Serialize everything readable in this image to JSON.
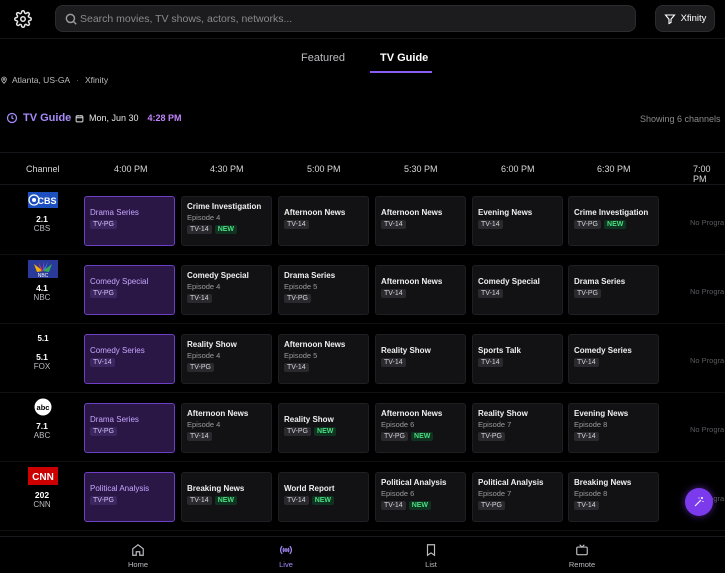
{
  "search": {
    "placeholder": "Search movies, TV shows, actors, networks..."
  },
  "provider_label": "Xfinity",
  "tabs": [
    {
      "label": "Featured",
      "active": false
    },
    {
      "label": "TV Guide",
      "active": true
    }
  ],
  "location": {
    "city": "Atlanta, US-GA",
    "provider": "Xfinity"
  },
  "guide": {
    "title": "TV Guide",
    "date": "Mon, Jun 30",
    "current_time": "4:28 PM",
    "showing": "Showing 6 channels",
    "channel_header": "Channel",
    "time_slots": [
      "4:00 PM",
      "4:30 PM",
      "5:00 PM",
      "5:30 PM",
      "6:00 PM",
      "6:30 PM",
      "7:00 PM"
    ],
    "no_program_label": "No Progra"
  },
  "channels": [
    {
      "number": "2.1",
      "name": "CBS",
      "logo": "CBS",
      "programs": [
        {
          "title": "Drama Series",
          "episode": "",
          "rating": "TV-PG",
          "new": false,
          "current": true
        },
        {
          "title": "Crime Investigation",
          "episode": "Episode 4",
          "rating": "TV-14",
          "new": true,
          "current": false
        },
        {
          "title": "Afternoon News",
          "episode": "",
          "rating": "TV-14",
          "new": false,
          "current": false
        },
        {
          "title": "Afternoon News",
          "episode": "",
          "rating": "TV-14",
          "new": false,
          "current": false
        },
        {
          "title": "Evening News",
          "episode": "",
          "rating": "TV-14",
          "new": false,
          "current": false
        },
        {
          "title": "Crime Investigation",
          "episode": "",
          "rating": "TV-PG",
          "new": true,
          "current": false
        }
      ]
    },
    {
      "number": "4.1",
      "name": "NBC",
      "logo": "NBC",
      "programs": [
        {
          "title": "Comedy Special",
          "episode": "",
          "rating": "TV-PG",
          "new": false,
          "current": true
        },
        {
          "title": "Comedy Special",
          "episode": "Episode 4",
          "rating": "TV-14",
          "new": false,
          "current": false
        },
        {
          "title": "Drama Series",
          "episode": "Episode 5",
          "rating": "TV-PG",
          "new": false,
          "current": false
        },
        {
          "title": "Afternoon News",
          "episode": "",
          "rating": "TV-14",
          "new": false,
          "current": false
        },
        {
          "title": "Comedy Special",
          "episode": "",
          "rating": "TV-14",
          "new": false,
          "current": false
        },
        {
          "title": "Drama Series",
          "episode": "",
          "rating": "TV-PG",
          "new": false,
          "current": false
        }
      ]
    },
    {
      "number": "5.1",
      "name": "FOX",
      "logo": "5.1",
      "programs": [
        {
          "title": "Comedy Series",
          "episode": "",
          "rating": "TV-14",
          "new": false,
          "current": true
        },
        {
          "title": "Reality Show",
          "episode": "Episode 4",
          "rating": "TV-PG",
          "new": false,
          "current": false
        },
        {
          "title": "Afternoon News",
          "episode": "Episode 5",
          "rating": "TV-14",
          "new": false,
          "current": false
        },
        {
          "title": "Reality Show",
          "episode": "",
          "rating": "TV-14",
          "new": false,
          "current": false
        },
        {
          "title": "Sports Talk",
          "episode": "",
          "rating": "TV-14",
          "new": false,
          "current": false
        },
        {
          "title": "Comedy Series",
          "episode": "",
          "rating": "TV-14",
          "new": false,
          "current": false
        }
      ]
    },
    {
      "number": "7.1",
      "name": "ABC",
      "logo": "abc",
      "programs": [
        {
          "title": "Drama Series",
          "episode": "",
          "rating": "TV-PG",
          "new": false,
          "current": true
        },
        {
          "title": "Afternoon News",
          "episode": "Episode 4",
          "rating": "TV-14",
          "new": false,
          "current": false
        },
        {
          "title": "Reality Show",
          "episode": "",
          "rating": "TV-PG",
          "new": true,
          "current": false
        },
        {
          "title": "Afternoon News",
          "episode": "Episode 6",
          "rating": "TV-PG",
          "new": true,
          "current": false
        },
        {
          "title": "Reality Show",
          "episode": "Episode 7",
          "rating": "TV-PG",
          "new": false,
          "current": false
        },
        {
          "title": "Evening News",
          "episode": "Episode 8",
          "rating": "TV-14",
          "new": false,
          "current": false
        }
      ]
    },
    {
      "number": "202",
      "name": "CNN",
      "logo": "CNN",
      "programs": [
        {
          "title": "Political Analysis",
          "episode": "",
          "rating": "TV-PG",
          "new": false,
          "current": true
        },
        {
          "title": "Breaking News",
          "episode": "",
          "rating": "TV-14",
          "new": true,
          "current": false
        },
        {
          "title": "World Report",
          "episode": "",
          "rating": "TV-14",
          "new": true,
          "current": false
        },
        {
          "title": "Political Analysis",
          "episode": "Episode 6",
          "rating": "TV-14",
          "new": true,
          "current": false
        },
        {
          "title": "Political Analysis",
          "episode": "Episode 7",
          "rating": "TV-PG",
          "new": false,
          "current": false
        },
        {
          "title": "Breaking News",
          "episode": "Episode 8",
          "rating": "TV-14",
          "new": false,
          "current": false
        }
      ]
    }
  ],
  "nav": [
    {
      "label": "Home",
      "icon": "home-icon",
      "active": false
    },
    {
      "label": "Live",
      "icon": "live-icon",
      "active": true
    },
    {
      "label": "List",
      "icon": "bookmark-icon",
      "active": false
    },
    {
      "label": "Remote",
      "icon": "tv-icon",
      "active": false
    }
  ],
  "colors": {
    "accent": "#8b5cf6",
    "current_cell": "#2a1746",
    "new_badge": "#4ade80"
  }
}
